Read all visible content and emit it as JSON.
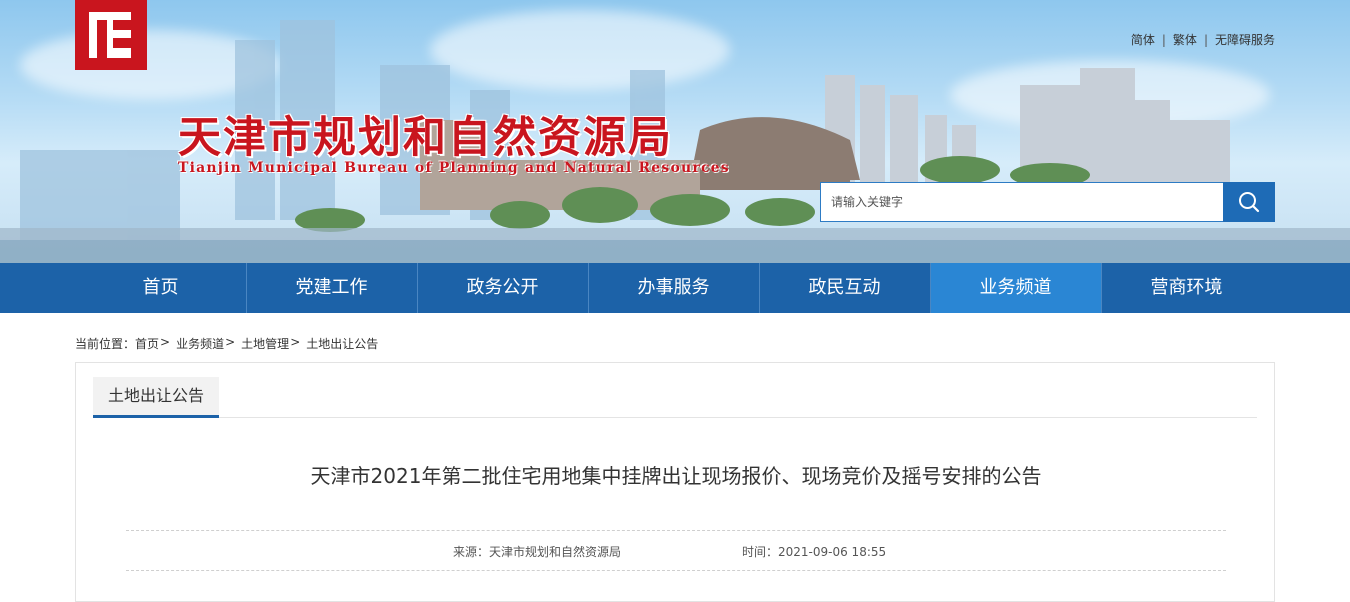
{
  "header": {
    "title_cn": "天津市规划和自然资源局",
    "title_en": "Tianjin Municipal Bureau of Planning and Natural Resources",
    "brand_color": "#c9151e",
    "top_links": [
      "简体",
      "繁体",
      "无障碍服务"
    ],
    "search": {
      "placeholder": "请输入关键字",
      "button_icon": "search-icon"
    }
  },
  "nav": {
    "items": [
      "首页",
      "党建工作",
      "政务公开",
      "办事服务",
      "政民互动",
      "业务频道",
      "营商环境"
    ],
    "active": "业务频道",
    "bar_color": "#1c62a8",
    "active_color": "#2a86d4"
  },
  "breadcrumb": {
    "label": "当前位置：",
    "items": [
      "首页",
      "业务频道",
      "土地管理",
      "土地出让公告"
    ],
    "separator": ">"
  },
  "panel": {
    "tab_label": "土地出让公告",
    "article_title": "天津市2021年第二批住宅用地集中挂牌出让现场报价、现场竞价及摇号安排的公告",
    "source": "来源：天津市规划和自然资源局",
    "time": "时间：2021-09-06 18:55"
  }
}
